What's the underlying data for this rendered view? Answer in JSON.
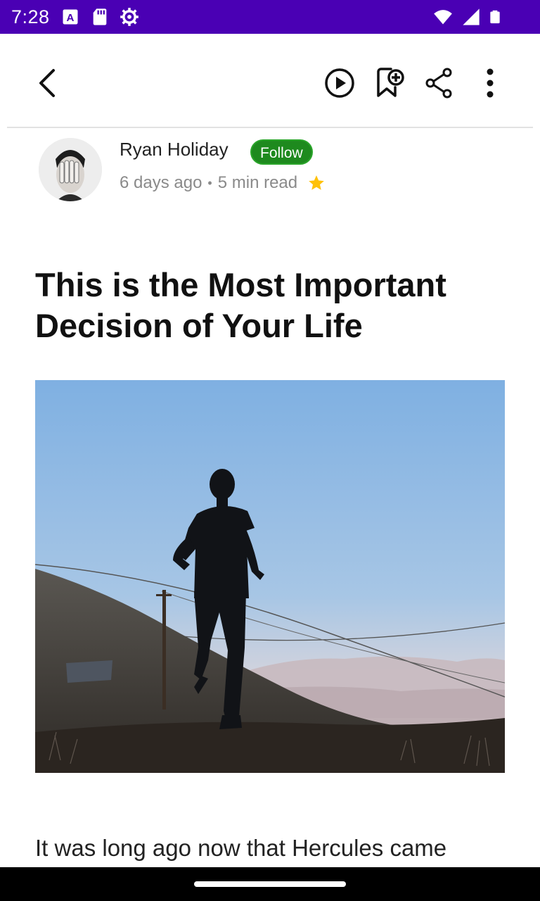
{
  "status_bar": {
    "time": "7:28",
    "left_icons": [
      "a-box-icon",
      "sd-card-icon",
      "gear-icon"
    ],
    "right_icons": [
      "wifi-icon",
      "signal-icon",
      "battery-icon"
    ],
    "background": "#4a00b4"
  },
  "toolbar": {
    "icons": [
      "back-arrow-icon",
      "play-icon",
      "bookmark-add-icon",
      "share-icon",
      "more-vert-icon"
    ]
  },
  "author": {
    "name": "Ryan Holiday",
    "follow_label": "Follow",
    "published": "6 days ago",
    "separator": "•",
    "read_time": "5 min read",
    "member_star": "star-icon"
  },
  "article": {
    "title": "This is the Most Important Decision of Your Life",
    "first_line": "It was long ago now that Hercules came"
  },
  "colors": {
    "accent_green": "#1e8a1e",
    "star_yellow": "#ffc107",
    "title_text": "#111111",
    "meta_text": "#8a8a8a"
  }
}
